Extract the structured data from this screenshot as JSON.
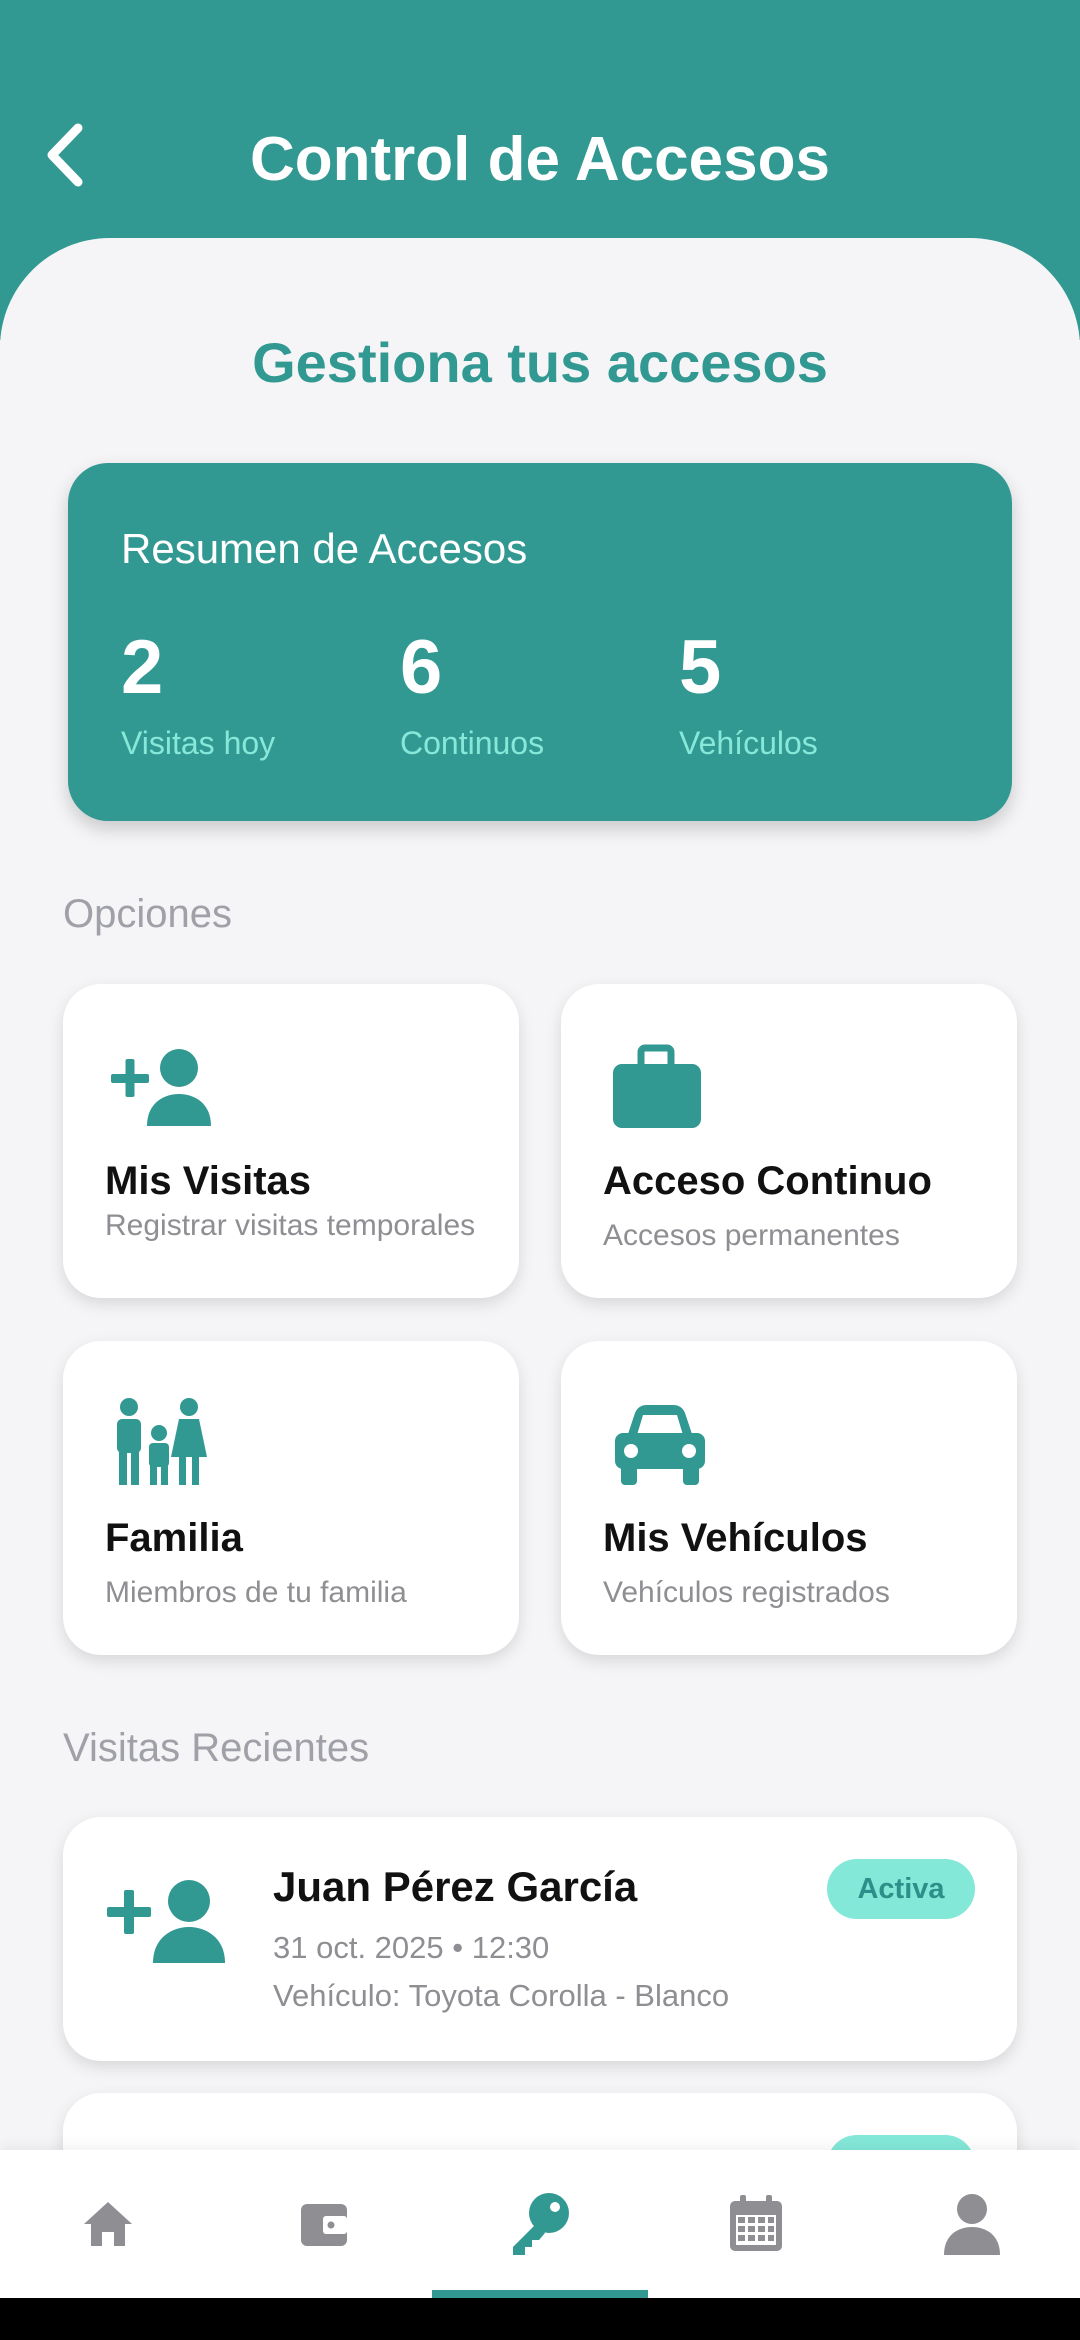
{
  "header": {
    "title": "Control de Accesos"
  },
  "page_title": "Gestiona tus accesos",
  "summary": {
    "title": "Resumen de Accesos",
    "stats": [
      {
        "value": "2",
        "label": "Visitas hoy"
      },
      {
        "value": "6",
        "label": "Continuos"
      },
      {
        "value": "5",
        "label": "Vehículos"
      }
    ]
  },
  "options": {
    "label": "Opciones",
    "items": [
      {
        "title": "Mis Visitas",
        "subtitle": "Registrar visitas temporales",
        "icon": "add-person-icon"
      },
      {
        "title": "Acceso Continuo",
        "subtitle": "Accesos permanentes",
        "icon": "briefcase-icon"
      },
      {
        "title": "Familia",
        "subtitle": "Miembros de tu familia",
        "icon": "family-icon"
      },
      {
        "title": "Mis Vehículos",
        "subtitle": "Vehículos registrados",
        "icon": "car-icon"
      }
    ]
  },
  "recent": {
    "label": "Visitas Recientes",
    "items": [
      {
        "name": "Juan Pérez García",
        "datetime": "31 oct. 2025 • 12:30",
        "vehicle": "Vehículo: Toyota Corolla - Blanco",
        "status": "Activa"
      }
    ]
  },
  "nav": {
    "items": [
      "home-icon",
      "wallet-icon",
      "key-icon",
      "calendar-icon",
      "profile-icon"
    ],
    "active": 2
  },
  "colors": {
    "primary": "#329892",
    "accent_light": "#87e8d9",
    "badge_bg": "#84e8d8",
    "nav_inactive": "#8e8e93"
  }
}
